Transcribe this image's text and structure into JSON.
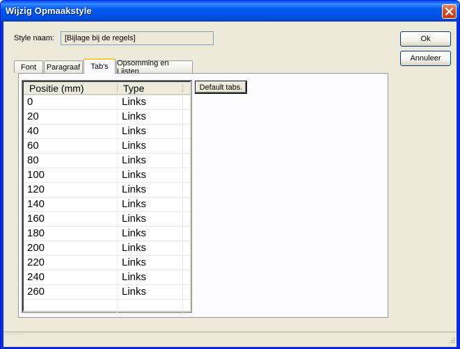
{
  "window": {
    "title": "Wijzig Opmaakstyle"
  },
  "style_name": {
    "label": "Style naam:",
    "value": "[Bijlage bij de regels]"
  },
  "buttons": {
    "ok": "Ok",
    "cancel": "Annuleer",
    "default_tabs": "Default tabs."
  },
  "tabs": [
    {
      "label": "Font",
      "active": false
    },
    {
      "label": "Paragraaf",
      "active": false
    },
    {
      "label": "Tab's",
      "active": true
    },
    {
      "label": "Opsomming en Lijsten",
      "active": false
    }
  ],
  "tab_list": {
    "columns": [
      "Positie (mm)",
      "Type"
    ],
    "rows": [
      {
        "position": "0",
        "type": "Links"
      },
      {
        "position": "20",
        "type": "Links"
      },
      {
        "position": "40",
        "type": "Links"
      },
      {
        "position": "60",
        "type": "Links"
      },
      {
        "position": "80",
        "type": "Links"
      },
      {
        "position": "100",
        "type": "Links"
      },
      {
        "position": "120",
        "type": "Links"
      },
      {
        "position": "140",
        "type": "Links"
      },
      {
        "position": "160",
        "type": "Links"
      },
      {
        "position": "180",
        "type": "Links"
      },
      {
        "position": "200",
        "type": "Links"
      },
      {
        "position": "220",
        "type": "Links"
      },
      {
        "position": "240",
        "type": "Links"
      },
      {
        "position": "260",
        "type": "Links"
      }
    ]
  },
  "icons": {
    "close": "close-icon",
    "size_grip": "size-grip-icon"
  }
}
